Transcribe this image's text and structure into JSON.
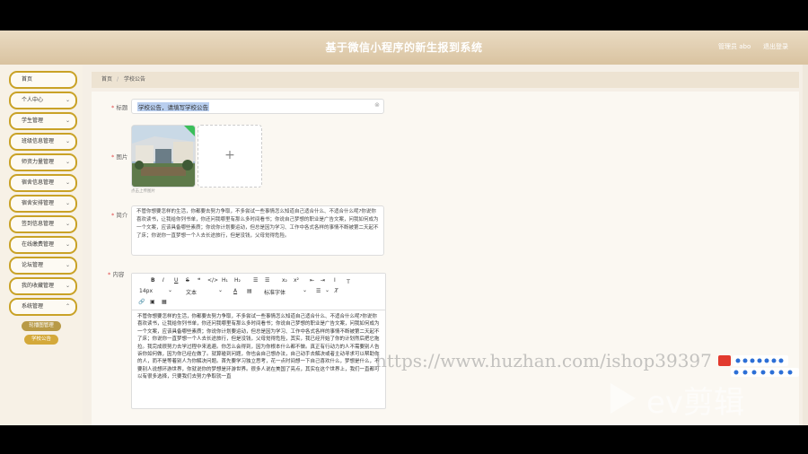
{
  "header": {
    "title": "基于微信小程序的新生报到系统",
    "user": "管理员 abo",
    "logout": "退出登录"
  },
  "sidebar": {
    "items": [
      {
        "label": "首页",
        "chevron": ""
      },
      {
        "label": "个人中心",
        "chevron": "⌄"
      },
      {
        "label": "学生管理",
        "chevron": "⌄"
      },
      {
        "label": "班级信息管理",
        "chevron": "⌄"
      },
      {
        "label": "师资力量管理",
        "chevron": "⌄"
      },
      {
        "label": "宿舍信息管理",
        "chevron": "⌄"
      },
      {
        "label": "宿舍安排管理",
        "chevron": "⌄"
      },
      {
        "label": "签到信息管理",
        "chevron": "⌄"
      },
      {
        "label": "在线缴费管理",
        "chevron": "⌄"
      },
      {
        "label": "论坛管理",
        "chevron": "⌄"
      },
      {
        "label": "我的收藏管理",
        "chevron": "⌄"
      },
      {
        "label": "系统管理",
        "chevron": "⌃"
      }
    ],
    "sub_items": [
      {
        "label": "轮播图管理"
      },
      {
        "label": "学校公告"
      }
    ]
  },
  "breadcrumb": {
    "home": "首页",
    "sep": "/",
    "current": "学校公告"
  },
  "form": {
    "title_label": "标题",
    "title_value": "学校公告，请填写学校公告",
    "image_label": "图片",
    "image_hint": "点击上传图片",
    "intro_label": "简介",
    "intro_text": "不管你想要怎样的生活，你都要去努力争取，不多尝试一些事情怎么知道自己适合什么、不适合什么呢?你说你喜欢读书，让我给你列书单，你还问我哪里有那么多时间看书；你说自己梦想的职业是广告文案，问我如何成为一个文案，应该具备哪些素质；你说你计划要运动，但总是因为学习、工作中各式各样的事情不断被第二天起不了床；你说你一直梦想一个人去长途旅行，但是没钱，父母觉得危险。",
    "content_label": "内容",
    "toolbar_row1": [
      "B",
      "I",
      "U",
      "S",
      "❝",
      "</>",
      "H₁",
      "H₂",
      "☰",
      "☰",
      "x₂",
      "x²",
      "⇤",
      "⇥",
      "Ⅰ",
      "Ｔ"
    ],
    "toolbar_row2": [
      "14px",
      "⌄",
      "文本",
      "⌄",
      "A",
      "▤",
      "标准字体",
      "⌄",
      "☰",
      "⌄",
      "T̸"
    ],
    "toolbar_row3": [
      "🔗",
      "▣",
      "▦"
    ],
    "content_text": "不管你想要怎样的生活，你都要去努力争取，不多尝试一些事情怎么知道自己适合什么、不适合什么呢?你说你喜欢读书，让我给你列书单，你还问我哪里有那么多时间看书；你说自己梦想的职业是广告文案，问我如何成为一个文案，应该具备哪些素质；你说你计划要运动，但总是因为学习、工作中各式各样的事情不断被第二天起不了床；你说你一直梦想一个人去长途旅行，但是没钱，父母觉得危险，其实，我已经开始了你的计划然后把它拖拉。我完成很努力去学过程中来逃避。你怎么会得到，因为你根本什么都不做。真正有行动力的人不需要别人告诉你如何做，因为你已经在做了。就算碰到问题，你也会自己想办法，自己动手去解决或者主动寻求可以帮助你的人，而不是等着别人为你解决问题。首先要学习独立思考，花一点时间想一下自己喜欢什么，梦想是什么，不要别人说想环游世界，你就说你的梦想是环游世界。很多人说在美国了亮点，其实在这个世界上，我们一直都可以有很多选择，只要我们去努力争取就一直"
  },
  "overlay": {
    "watermark": "https://www.huzhan.com/ishop39397",
    "logo_text": "ev剪辑"
  }
}
